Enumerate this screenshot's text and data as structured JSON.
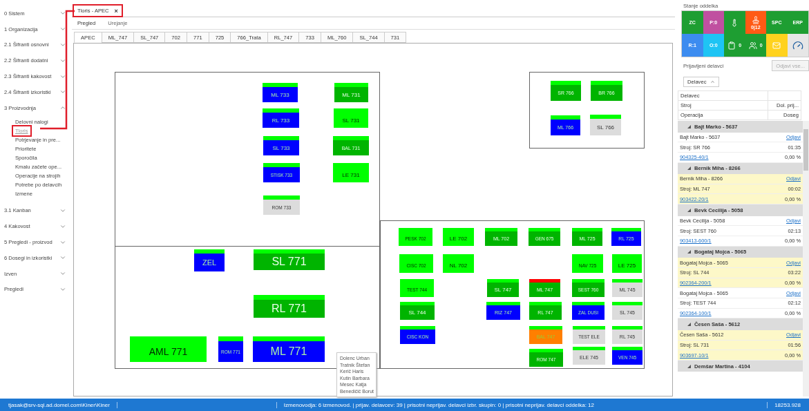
{
  "sidebar": {
    "items": [
      {
        "label": "0 Sistem",
        "expanded": false
      },
      {
        "label": "1 Organizacija",
        "expanded": false
      },
      {
        "label": "2.1 Šifranti osnovni",
        "expanded": false
      },
      {
        "label": "2.2 Šifranti dodatni",
        "expanded": false
      },
      {
        "label": "2.3 Šifranti kakovost",
        "expanded": false
      },
      {
        "label": "2.4 Šifranti izkoristki",
        "expanded": false
      },
      {
        "label": "3 Proizvodnja",
        "expanded": true,
        "children": [
          {
            "label": "Delovni nalogi",
            "selected": false,
            "highlighted": false
          },
          {
            "label": "Tloris",
            "selected": true,
            "highlighted": true
          },
          {
            "label": "Potrjevanje in pre...",
            "selected": false,
            "highlighted": false
          },
          {
            "label": "Prioritete",
            "selected": false,
            "highlighted": false
          },
          {
            "label": "Sporočila",
            "selected": false,
            "highlighted": false
          },
          {
            "label": "Kmalu začete ope...",
            "selected": false,
            "highlighted": false
          },
          {
            "label": "Operacije na strojih",
            "selected": false,
            "highlighted": false
          },
          {
            "label": "Potrebe po delavcih",
            "selected": false,
            "highlighted": false
          },
          {
            "label": "Izmene",
            "selected": false,
            "highlighted": false
          }
        ]
      },
      {
        "label": "3.1 Kanban",
        "expanded": false
      },
      {
        "label": "4 Kakovost",
        "expanded": false
      },
      {
        "label": "5 Pregledi - proizvod",
        "expanded": false
      },
      {
        "label": "6 Dosegi in izkoristki",
        "expanded": false
      },
      {
        "label": "Izven",
        "expanded": false
      },
      {
        "label": "Pregledi",
        "expanded": false
      }
    ]
  },
  "doc_tabs": [
    {
      "label": "Tloris - APEC",
      "close": "×",
      "selected": true,
      "highlighted": true
    }
  ],
  "view_modes": [
    {
      "label": "Pregled",
      "selected": true
    },
    {
      "label": "Urejanje",
      "selected": false
    }
  ],
  "floor_tabs": [
    {
      "label": "APEC",
      "selected": true
    },
    {
      "label": "ML_747",
      "selected": false
    },
    {
      "label": "SL_747",
      "selected": false
    },
    {
      "label": "702",
      "selected": false
    },
    {
      "label": "771",
      "selected": false
    },
    {
      "label": "725",
      "selected": false
    },
    {
      "label": "766_Trata",
      "selected": false
    },
    {
      "label": "RL_747",
      "selected": false
    },
    {
      "label": "733",
      "selected": false
    },
    {
      "label": "ML_760",
      "selected": false
    },
    {
      "label": "SL_744",
      "selected": false
    },
    {
      "label": "731",
      "selected": false
    }
  ],
  "machines": [
    {
      "label": "ML 733",
      "color": "#0000ff",
      "alarm": false
    },
    {
      "label": "RL 733",
      "color": "#0000ff",
      "alarm": false
    },
    {
      "label": "SL 733",
      "color": "#0000ff",
      "alarm": false
    },
    {
      "label": "STISK 733",
      "color": "#0000ff",
      "alarm": false
    },
    {
      "label": "ROM 733",
      "color": "#dcdcdc",
      "alarm": false
    },
    {
      "label": "ML 731",
      "color": "#00b400",
      "alarm": false
    },
    {
      "label": "SL 731",
      "color": "#00ff00",
      "alarm": false
    },
    {
      "label": "BAL 731",
      "color": "#00b400",
      "alarm": false
    },
    {
      "label": "LE 731",
      "color": "#00ff00",
      "alarm": false
    },
    {
      "label": "ZEL",
      "color": "#0000ff",
      "alarm": false
    },
    {
      "label": "SL 771",
      "color": "#00b400",
      "alarm": false
    },
    {
      "label": "RL 771",
      "color": "#00b400",
      "alarm": false
    },
    {
      "label": "AML 771",
      "color": "#00ff00",
      "alarm": false
    },
    {
      "label": "ROM 771",
      "color": "#0000ff",
      "alarm": false
    },
    {
      "label": "ML 771",
      "color": "#0000ff",
      "alarm": false
    },
    {
      "label": "SR 766",
      "color": "#00b400",
      "alarm": false
    },
    {
      "label": "BR 766",
      "color": "#00b400",
      "alarm": false
    },
    {
      "label": "ML 766",
      "color": "#0000ff",
      "alarm": false
    },
    {
      "label": "SL 766",
      "color": "#dcdcdc",
      "alarm": false
    },
    {
      "label": "PESK 702",
      "color": "#00ff00",
      "alarm": false
    },
    {
      "label": "LE 702",
      "color": "#00ff00",
      "alarm": false
    },
    {
      "label": "ML 702",
      "color": "#00b400",
      "alarm": false
    },
    {
      "label": "GEN 675",
      "color": "#00b400",
      "alarm": false
    },
    {
      "label": "ML 725",
      "color": "#00b400",
      "alarm": false
    },
    {
      "label": "RL 725",
      "color": "#0000ff",
      "alarm": false
    },
    {
      "label": "CISC 702",
      "color": "#00ff00",
      "alarm": false
    },
    {
      "label": "NL 702",
      "color": "#00ff00",
      "alarm": false
    },
    {
      "label": "NAV 725",
      "color": "#00ff00",
      "alarm": false
    },
    {
      "label": "LE 725",
      "color": "#00ff00",
      "alarm": false
    },
    {
      "label": "TEST 744",
      "color": "#00ff00",
      "alarm": false
    },
    {
      "label": "SL 747",
      "color": "#00b400",
      "alarm": false
    },
    {
      "label": "ML 747",
      "color": "#00b400",
      "alarm": true
    },
    {
      "label": "SEST 760",
      "color": "#00b400",
      "alarm": false
    },
    {
      "label": "ML 745",
      "color": "#dcdcdc",
      "alarm": false
    },
    {
      "label": "SL 744",
      "color": "#00b400",
      "alarm": false
    },
    {
      "label": "RIZ 747",
      "color": "#0000ff",
      "alarm": false
    },
    {
      "label": "RL 747",
      "color": "#00b400",
      "alarm": false
    },
    {
      "label": "ZAL DUSI",
      "color": "#0000ff",
      "alarm": false
    },
    {
      "label": "SL 745",
      "color": "#dcdcdc",
      "alarm": false
    },
    {
      "label": "CISC KON",
      "color": "#0000ff",
      "alarm": false
    },
    {
      "label": "BAL 747",
      "color": "#ff7f00",
      "alarm": false
    },
    {
      "label": "TEST ELE",
      "color": "#dcdcdc",
      "alarm": false
    },
    {
      "label": "RL 745",
      "color": "#dcdcdc",
      "alarm": false
    },
    {
      "label": "ROM 747",
      "color": "#00b400",
      "alarm": false
    },
    {
      "label": "ELE 745",
      "color": "#dcdcdc",
      "alarm": false
    },
    {
      "label": "VEN 745",
      "color": "#0000ff",
      "alarm": false
    }
  ],
  "tooltip": {
    "names": [
      "Dolenc Urban",
      "Tratnik Štefan",
      "Kerič Haris",
      "Kutin Barbara",
      "Mesec Katja",
      "Benedičič Borut"
    ]
  },
  "department_status": {
    "title": "Stanje oddelka",
    "tiles": [
      {
        "kind": "text",
        "label": "ZC",
        "color": "#1e9e32"
      },
      {
        "kind": "text",
        "label": "P:0",
        "color": "#c050a0"
      },
      {
        "kind": "icon",
        "color": "#1e9e32"
      },
      {
        "kind": "icon_count",
        "label": "0|12",
        "color": "#ff5a14"
      },
      {
        "kind": "text",
        "label": "SPC",
        "color": "#1e9e32"
      },
      {
        "kind": "text",
        "label": "ERP",
        "color": "#1e9e32"
      },
      {
        "kind": "text",
        "label": "R:1",
        "color": "#3c8cf0"
      },
      {
        "kind": "text",
        "label": "O:0",
        "color": "#1ec4f4"
      },
      {
        "kind": "icon_count",
        "label": "0",
        "color": "#1e9e32"
      },
      {
        "kind": "icon_count",
        "label": "0",
        "color": "#1e9e32"
      },
      {
        "kind": "icon",
        "color": "#ffd21e"
      },
      {
        "kind": "icon",
        "color": "#e6e6e6"
      }
    ]
  },
  "workers_panel": {
    "title": "Prijavljeni delavci",
    "logout_all": {
      "label": "Odjavi vse...",
      "disabled": true
    },
    "group_by": "Delavec",
    "columns": [
      {
        "label": "Delavec"
      },
      {
        "label": "Stroj",
        "right_label": "Dol. prij..."
      },
      {
        "label": "Operacija",
        "right_label": "Doseg"
      }
    ],
    "groups": [
      {
        "name": "Bajt Marko - 5637",
        "entries": [
          {
            "worker": "Bajt Marko - 5637",
            "logout": "Odjavi",
            "machine": "Stroj: SR 766",
            "time": "01:35",
            "order": "904325-40/1",
            "progress": "0,00 %",
            "highlighted": false
          }
        ]
      },
      {
        "name": "Bernik Miha - 8266",
        "entries": [
          {
            "worker": "Bernik Miha - 8266",
            "logout": "Odjavi",
            "machine": "Stroj: ML 747",
            "time": "00:02",
            "order": "903422-20/1",
            "progress": "0,00 %",
            "highlighted": true
          }
        ]
      },
      {
        "name": "Bevk Cecilija - 5058",
        "entries": [
          {
            "worker": "Bevk Cecilija - 5058",
            "logout": "Odjavi",
            "machine": "Stroj: SEST 760",
            "time": "02:13",
            "order": "903413-600/1",
            "progress": "0,00 %",
            "highlighted": false
          }
        ]
      },
      {
        "name": "Bogataj Mojca - 5065",
        "entries": [
          {
            "worker": "Bogataj Mojca - 5065",
            "logout": "Odjavi",
            "machine": "Stroj: SL 744",
            "time": "03:22",
            "order": "902364-200/1",
            "progress": "0,00 %",
            "highlighted": true
          },
          {
            "worker": "Bogataj Mojca - 5065",
            "logout": "Odjavi",
            "machine": "Stroj: TEST 744",
            "time": "02:12",
            "order": "902364-100/1",
            "progress": "0,00 %",
            "highlighted": false
          }
        ]
      },
      {
        "name": "Česen Saša - 5612",
        "entries": [
          {
            "worker": "Česen Saša - 5612",
            "logout": "Odjavi",
            "machine": "Stroj: SL 731",
            "time": "01:56",
            "order": "903697-10/1",
            "progress": "0,00 %",
            "highlighted": true
          }
        ]
      },
      {
        "name": "Demšar Martina - 4104"
      }
    ]
  },
  "status_bar": {
    "user": "tjasak@srv-sql.ad.domel.com\\Kiner\\Kiner",
    "summary": "Izmenovodja: 6 izmenovod. | prijav. delavcev: 39 | prisotni neprijav. delavci izbr. skupin: 0 | prisotni neprijav. delavci oddelka: 12",
    "value": "18253.928"
  }
}
